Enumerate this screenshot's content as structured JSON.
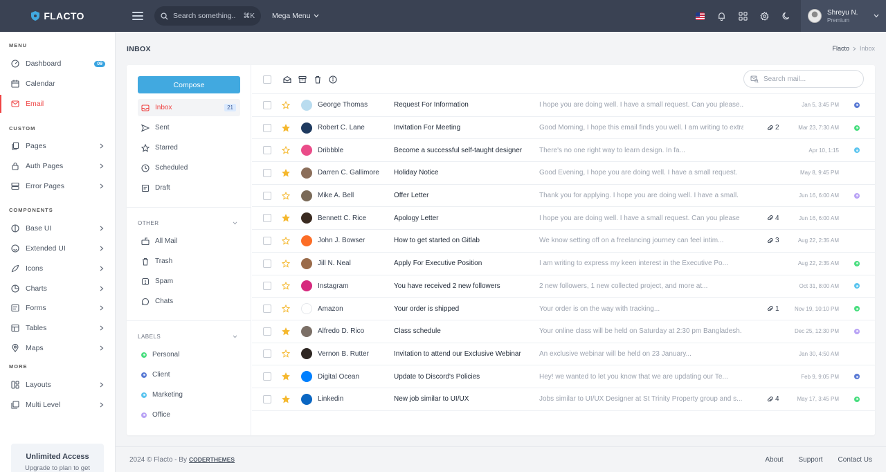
{
  "brand": {
    "name": "FLACTO",
    "accent": "#41a9e0"
  },
  "topbar": {
    "search_placeholder": "Search something..",
    "search_shortcut": "⌘K",
    "mega_menu_label": "Mega Menu",
    "user": {
      "name": "Shreyu N.",
      "role": "Premium"
    }
  },
  "sidebar": {
    "sections": [
      {
        "title": "MENU"
      },
      {
        "title": "CUSTOM"
      },
      {
        "title": "COMPONENTS"
      },
      {
        "title": "MORE"
      }
    ],
    "items": [
      {
        "label": "Dashboard",
        "badge": "09"
      },
      {
        "label": "Calendar"
      },
      {
        "label": "Email"
      },
      {
        "label": "Pages"
      },
      {
        "label": "Auth Pages"
      },
      {
        "label": "Error Pages"
      },
      {
        "label": "Base UI"
      },
      {
        "label": "Extended UI"
      },
      {
        "label": "Icons"
      },
      {
        "label": "Charts"
      },
      {
        "label": "Forms"
      },
      {
        "label": "Tables"
      },
      {
        "label": "Maps"
      },
      {
        "label": "Layouts"
      },
      {
        "label": "Multi Level"
      }
    ],
    "promo": {
      "title": "Unlimited Access",
      "subtitle": "Upgrade to plan to get"
    }
  },
  "page": {
    "title": "INBOX",
    "breadcrumb": [
      "Flacto",
      "Inbox"
    ]
  },
  "mailnav": {
    "compose_label": "Compose",
    "folders": [
      {
        "label": "Inbox",
        "count": "21"
      },
      {
        "label": "Sent"
      },
      {
        "label": "Starred"
      },
      {
        "label": "Scheduled"
      },
      {
        "label": "Draft"
      }
    ],
    "other_title": "OTHER",
    "other": [
      {
        "label": "All Mail"
      },
      {
        "label": "Trash"
      },
      {
        "label": "Spam"
      },
      {
        "label": "Chats"
      }
    ],
    "labels_title": "LABELS",
    "labels": [
      {
        "label": "Personal",
        "color": "#4ade80"
      },
      {
        "label": "Client",
        "color": "#5b7bd5"
      },
      {
        "label": "Marketing",
        "color": "#5cc5ef"
      },
      {
        "label": "Office",
        "color": "#b9a3f5"
      }
    ]
  },
  "mail": {
    "search_placeholder": "Search mail...",
    "emails": [
      {
        "sender": "George Thomas",
        "subject": "Request For Information",
        "preview": "I hope you are doing well. I have a small request. Can you please...",
        "attachments": "",
        "date": "Jan 5, 3:45 PM",
        "starred": false,
        "tag_color": "#5b7bd5",
        "avatar_color": "#b9dcef"
      },
      {
        "sender": "Robert C. Lane",
        "subject": "Invitation For Meeting",
        "preview": "Good Morning, I hope this email finds you well. I am writing to extra...",
        "attachments": "2",
        "date": "Mar 23, 7:30 AM",
        "starred": true,
        "tag_color": "#4ade80",
        "avatar_color": "#1e3a5f"
      },
      {
        "sender": "Dribbble",
        "subject": "Become a successful self-taught designer",
        "preview": "There's no one right way to learn design. In fa...",
        "attachments": "",
        "date": "Apr 10, 1:15",
        "starred": false,
        "tag_color": "#5cc5ef",
        "avatar_color": "#ea4c89"
      },
      {
        "sender": "Darren C. Gallimore",
        "subject": "Holiday Notice",
        "preview": "Good Evening, I hope you are doing well. I have a small request.",
        "attachments": "",
        "date": "May 8, 9:45 PM",
        "starred": true,
        "tag_color": "",
        "avatar_color": "#8b6e5a"
      },
      {
        "sender": "Mike A. Bell",
        "subject": "Offer Letter",
        "preview": "Thank you for applying. I hope you are doing well. I have a small.",
        "attachments": "",
        "date": "Jun 16, 6:00 AM",
        "starred": false,
        "tag_color": "#b9a3f5",
        "avatar_color": "#7a6a58"
      },
      {
        "sender": "Bennett C. Rice",
        "subject": "Apology Letter",
        "preview": "I hope you are doing well. I have a small request. Can you please",
        "attachments": "4",
        "date": "Jun 16, 6:00 AM",
        "starred": true,
        "tag_color": "",
        "avatar_color": "#3a2a20"
      },
      {
        "sender": "John J. Bowser",
        "subject": "How to get started on Gitlab",
        "preview": "We know setting off on a freelancing journey can feel intim...",
        "attachments": "3",
        "date": "Aug 22, 2:35 AM",
        "starred": false,
        "tag_color": "",
        "avatar_color": "#fc6d26"
      },
      {
        "sender": "Jill N. Neal",
        "subject": "Apply For Executive Position",
        "preview": "I am writing to express my keen interest in the Executive Po...",
        "attachments": "",
        "date": "Aug 22, 2:35 AM",
        "starred": false,
        "tag_color": "#4ade80",
        "avatar_color": "#9a6b4a"
      },
      {
        "sender": "Instagram",
        "subject": "You have received 2 new followers",
        "preview": "2 new followers, 1 new collected project, and more at...",
        "attachments": "",
        "date": "Oct 31, 8:00 AM",
        "starred": false,
        "tag_color": "#5cc5ef",
        "avatar_color": "#d6297e"
      },
      {
        "sender": "Amazon",
        "subject": "Your order is shipped",
        "preview": "Your order is on the way with tracking...",
        "attachments": "1",
        "date": "Nov 19, 10:10 PM",
        "starred": false,
        "tag_color": "#4ade80",
        "avatar_color": "#ffffff"
      },
      {
        "sender": "Alfredo D. Rico",
        "subject": "Class schedule",
        "preview": "Your online class will be held on Saturday at 2:30 pm Bangladesh.",
        "attachments": "",
        "date": "Dec 25, 12:30 PM",
        "starred": true,
        "tag_color": "#b9a3f5",
        "avatar_color": "#7b6f66"
      },
      {
        "sender": "Vernon B. Rutter",
        "subject": "Invitation to attend our Exclusive Webinar",
        "preview": "An exclusive webinar will be held on 23 January...",
        "attachments": "",
        "date": "Jan 30, 4:50 AM",
        "starred": false,
        "tag_color": "",
        "avatar_color": "#2e2622"
      },
      {
        "sender": "Digital Ocean",
        "subject": "Update to Discord's Policies",
        "preview": "Hey! we wanted to let you know that we are updating our Te...",
        "attachments": "",
        "date": "Feb 9, 9:05 PM",
        "starred": true,
        "tag_color": "#5b7bd5",
        "avatar_color": "#0080ff"
      },
      {
        "sender": "Linkedin",
        "subject": "New job similar to UI/UX",
        "preview": "Jobs similar to UI/UX Designer at St Trinity Property group and s...",
        "attachments": "4",
        "date": "May 17, 3:45 PM",
        "starred": true,
        "tag_color": "#4ade80",
        "avatar_color": "#0a66c2"
      }
    ]
  },
  "footer": {
    "copyright": "2024 © Flacto - By",
    "brand_link": "CODERTHEMES",
    "links": [
      "About",
      "Support",
      "Contact Us"
    ]
  }
}
